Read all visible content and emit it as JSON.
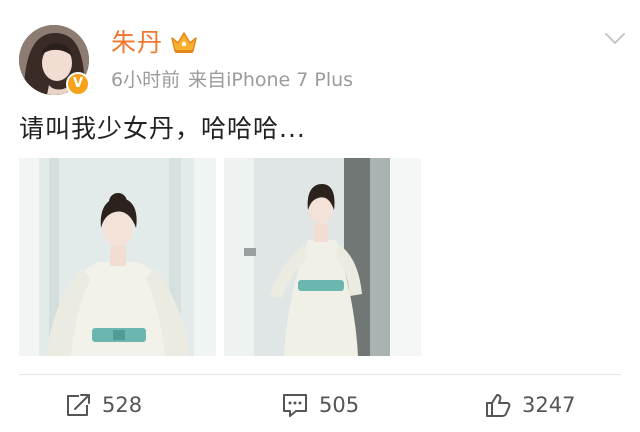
{
  "user": {
    "name": "朱丹",
    "verified_badge": "V",
    "avatar_icon": "user-avatar",
    "vip_icon": "crown-icon",
    "accent_color": "#f2762d",
    "badge_color": "#f7a21b"
  },
  "meta": {
    "time": "6小时前",
    "source": "来自iPhone 7 Plus"
  },
  "post": {
    "text": "请叫我少女丹，哈哈哈...",
    "photo_count": 2
  },
  "actions": {
    "repost_count": "528",
    "comment_count": "505",
    "like_count": "3247"
  }
}
